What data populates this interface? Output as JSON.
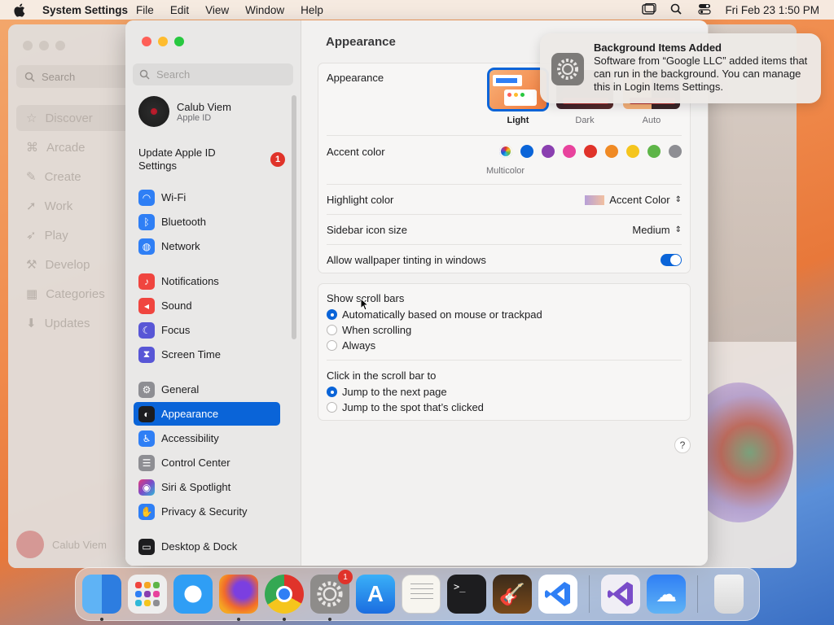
{
  "menubar": {
    "app_name": "System Settings",
    "menus": [
      "File",
      "Edit",
      "View",
      "Window",
      "Help"
    ],
    "clock": "Fri Feb 23  1:50 PM"
  },
  "appstore_bg": {
    "search_placeholder": "Search",
    "items": [
      "Discover",
      "Arcade",
      "Create",
      "Work",
      "Play",
      "Develop",
      "Categories",
      "Updates"
    ],
    "user": "Calub Viem"
  },
  "sidebar": {
    "search_placeholder": "Search",
    "profile_name": "Calub Viem",
    "profile_sub": "Apple ID",
    "update_label": "Update Apple ID Settings",
    "update_badge": "1",
    "items": [
      {
        "label": "Wi-Fi",
        "icon": "wifi-icon",
        "color": "#2f7ff5"
      },
      {
        "label": "Bluetooth",
        "icon": "bluetooth-icon",
        "color": "#2f7ff5"
      },
      {
        "label": "Network",
        "icon": "globe-icon",
        "color": "#2f7ff5"
      },
      {
        "label": "Notifications",
        "icon": "bell-icon",
        "color": "#f0453f"
      },
      {
        "label": "Sound",
        "icon": "speaker-icon",
        "color": "#f0453f"
      },
      {
        "label": "Focus",
        "icon": "moon-icon",
        "color": "#5856d6"
      },
      {
        "label": "Screen Time",
        "icon": "hourglass-icon",
        "color": "#5856d6"
      },
      {
        "label": "General",
        "icon": "gear-icon",
        "color": "#8e8e93"
      },
      {
        "label": "Appearance",
        "icon": "appearance-icon",
        "color": "#1d1d1f"
      },
      {
        "label": "Accessibility",
        "icon": "accessibility-icon",
        "color": "#2f7ff5"
      },
      {
        "label": "Control Center",
        "icon": "control-center-icon",
        "color": "#8e8e93"
      },
      {
        "label": "Siri & Spotlight",
        "icon": "siri-icon",
        "color": "#7a4cc9"
      },
      {
        "label": "Privacy & Security",
        "icon": "hand-icon",
        "color": "#2f7ff5"
      },
      {
        "label": "Desktop & Dock",
        "icon": "dock-icon",
        "color": "#1d1d1f"
      }
    ]
  },
  "main": {
    "title": "Appearance",
    "appearance_label": "Appearance",
    "themes": [
      "Light",
      "Dark",
      "Auto"
    ],
    "accent_label": "Accent color",
    "accent_colors": [
      "#0a64d8",
      "#8a3fb0",
      "#e8439d",
      "#e0332a",
      "#f08a24",
      "#f5c51d",
      "#5eb548",
      "#8e8e93"
    ],
    "accent_selected": "Multicolor",
    "highlight_label": "Highlight color",
    "highlight_value": "Accent Color",
    "sidebar_icon_label": "Sidebar icon size",
    "sidebar_icon_value": "Medium",
    "tinting_label": "Allow wallpaper tinting in windows",
    "tinting_on": true,
    "scrollbars_label": "Show scroll bars",
    "scrollbar_options": [
      "Automatically based on mouse or trackpad",
      "When scrolling",
      "Always"
    ],
    "click_label": "Click in the scroll bar to",
    "click_options": [
      "Jump to the next page",
      "Jump to the spot that’s clicked"
    ],
    "help": "?"
  },
  "notification": {
    "title": "Background Items Added",
    "body": "Software from “Google LLC” added items that can run in the background. You can manage this in Login Items Settings."
  },
  "dock": {
    "apps": [
      "Finder",
      "Launchpad",
      "Safari",
      "Firefox",
      "Chrome",
      "System Settings",
      "App Store",
      "TextEdit",
      "Terminal",
      "GarageBand",
      "Visual Studio Code",
      "Visual Studio",
      "Weather",
      "Trash"
    ],
    "settings_badge": "1"
  }
}
